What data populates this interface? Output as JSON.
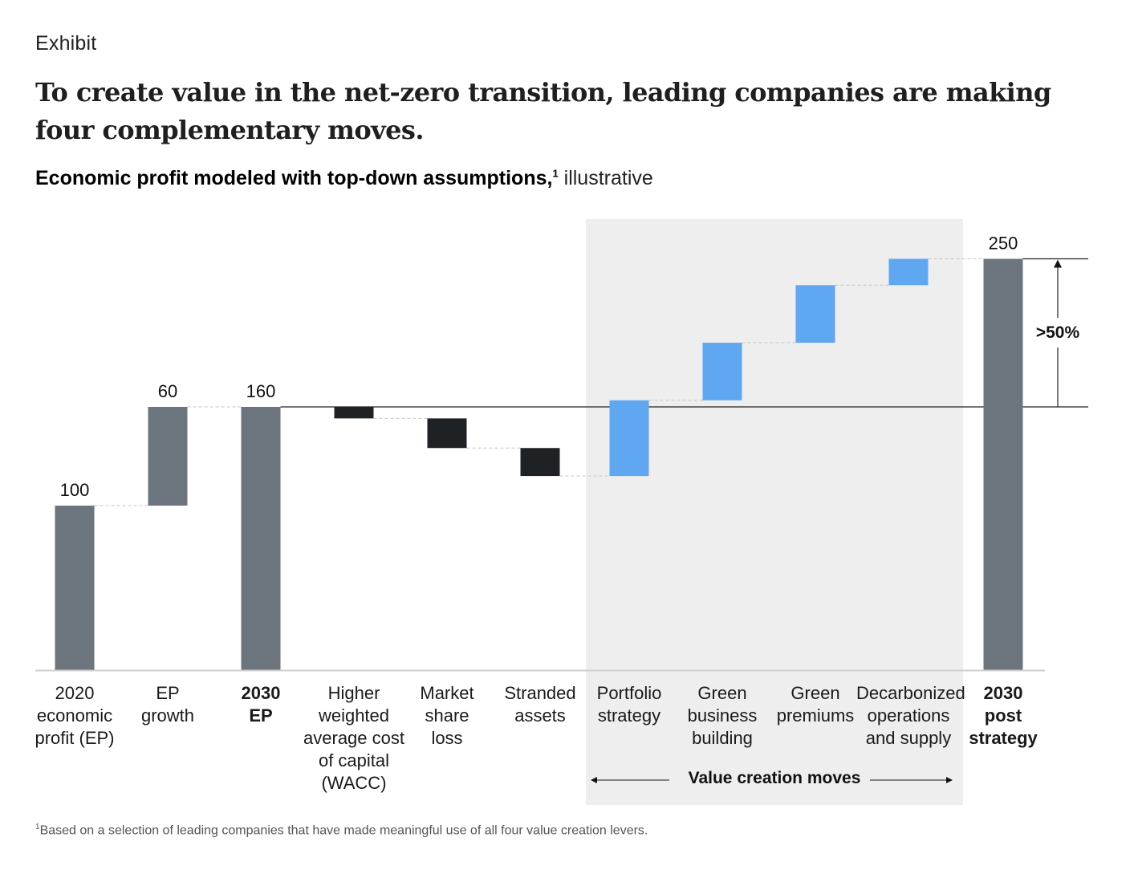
{
  "header": {
    "exhibit_label": "Exhibit",
    "title": "To create value in the net-zero transition, leading companies are making four complementary moves.",
    "subtitle_bold": "Economic profit modeled with top-down assumptions,",
    "subtitle_sup": "1",
    "subtitle_light": " illustrative"
  },
  "footnote": {
    "marker": "1",
    "text": "Based on a selection of leading companies that have made meaningful use of all four value creation levers."
  },
  "colors": {
    "total": "#6c747e",
    "negative": "#1f2225",
    "positive": "#60a7f2",
    "highlight_bg": "#eeeeee"
  },
  "chart_data": {
    "type": "bar",
    "subtype": "waterfall",
    "title": "Economic profit modeled with top-down assumptions, illustrative",
    "xlabel": "",
    "ylabel": "",
    "ylim": [
      0,
      250
    ],
    "grid": false,
    "categories": [
      "2020 economic profit (EP)",
      "EP growth",
      "2030 EP",
      "Higher weighted average cost of capital (WACC)",
      "Market share loss",
      "Stranded assets",
      "Portfolio strategy",
      "Green business building",
      "Green premiums",
      "Decarbonized operations and supply",
      "2030 post strategy"
    ],
    "category_lines": [
      [
        "2020",
        "economic",
        "profit (EP)"
      ],
      [
        "EP",
        "growth"
      ],
      [
        "2030",
        "EP"
      ],
      [
        "Higher",
        "weighted",
        "average cost",
        "of capital",
        "(WACC)"
      ],
      [
        "Market",
        "share",
        "loss"
      ],
      [
        "Stranded",
        "assets"
      ],
      [
        "Portfolio",
        "strategy"
      ],
      [
        "Green",
        "business",
        "building"
      ],
      [
        "Green",
        "premiums"
      ],
      [
        "Decarbonized",
        "operations",
        "and supply"
      ],
      [
        "2030",
        "post",
        "strategy"
      ]
    ],
    "bold_categories": [
      2,
      10
    ],
    "bars": [
      {
        "kind": "total",
        "start": 0,
        "end": 100,
        "label": "100"
      },
      {
        "kind": "increase",
        "start": 100,
        "end": 160,
        "label": "60"
      },
      {
        "kind": "total",
        "start": 0,
        "end": 160,
        "label": "160"
      },
      {
        "kind": "decrease",
        "start": 160,
        "end": 153,
        "label": ""
      },
      {
        "kind": "decrease",
        "start": 153,
        "end": 135,
        "label": ""
      },
      {
        "kind": "decrease",
        "start": 135,
        "end": 118,
        "label": ""
      },
      {
        "kind": "value-move",
        "start": 118,
        "end": 164,
        "label": ""
      },
      {
        "kind": "value-move",
        "start": 164,
        "end": 199,
        "label": ""
      },
      {
        "kind": "value-move",
        "start": 199,
        "end": 234,
        "label": ""
      },
      {
        "kind": "value-move",
        "start": 234,
        "end": 250,
        "label": ""
      },
      {
        "kind": "total",
        "start": 0,
        "end": 250,
        "label": "250"
      }
    ],
    "reference_line_value": 160,
    "annotations": [
      {
        "text": ">50%",
        "from": 160,
        "to": 250,
        "type": "arrow"
      },
      {
        "text": "Value creation moves",
        "spans_categories": [
          6,
          9
        ],
        "type": "bracket-arrow"
      }
    ]
  }
}
